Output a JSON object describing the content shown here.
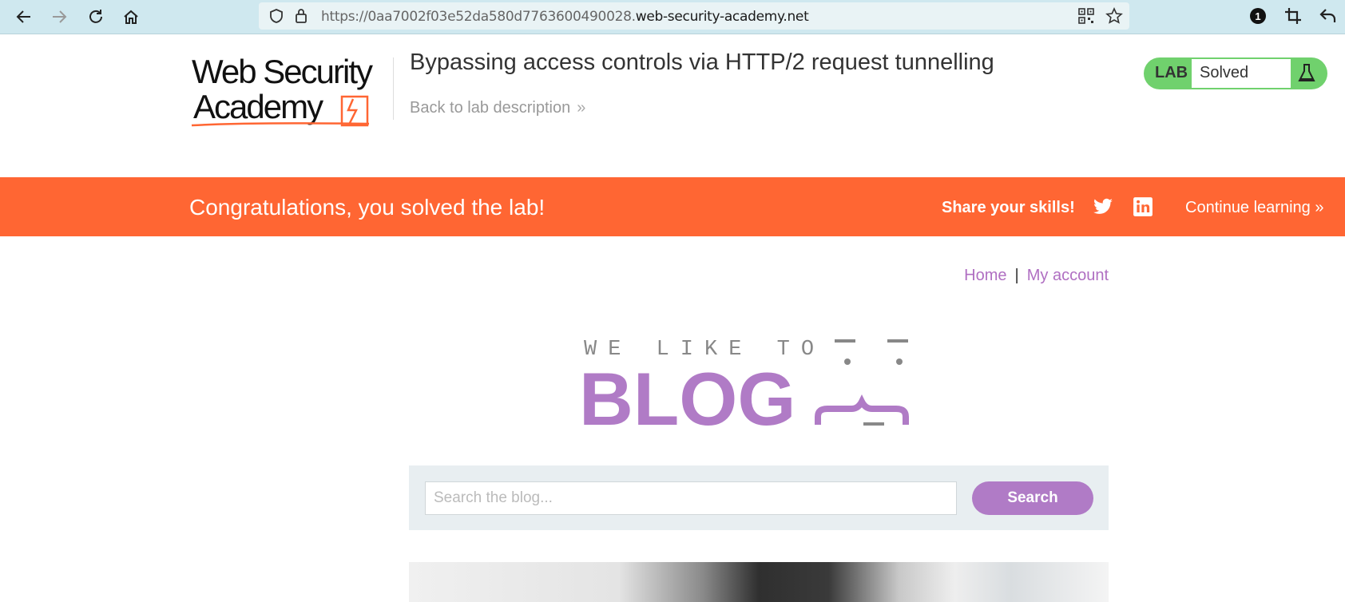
{
  "browser": {
    "url_prefix": "https://0aa7002f03e52da580d7763600490028.",
    "url_host": "web-security-academy.net",
    "notification_count": "1"
  },
  "header": {
    "logo_line1": "Web Security",
    "logo_line2": "Academy",
    "lab_title": "Bypassing access controls via HTTP/2 request tunnelling",
    "back_link": "Back to lab description",
    "lab_label": "LAB",
    "lab_status": "Solved",
    "colors": {
      "badge": "#70d16d",
      "accent": "#ff6633"
    }
  },
  "banner": {
    "message": "Congratulations, you solved the lab!",
    "share": "Share your skills!",
    "continue": "Continue learning"
  },
  "nav": {
    "home": "Home",
    "separator": "|",
    "account": "My account"
  },
  "blog_logo": {
    "tagline": "WE LIKE TO",
    "word": "BLOG"
  },
  "search": {
    "placeholder": "Search the blog...",
    "value": "",
    "button": "Search"
  }
}
